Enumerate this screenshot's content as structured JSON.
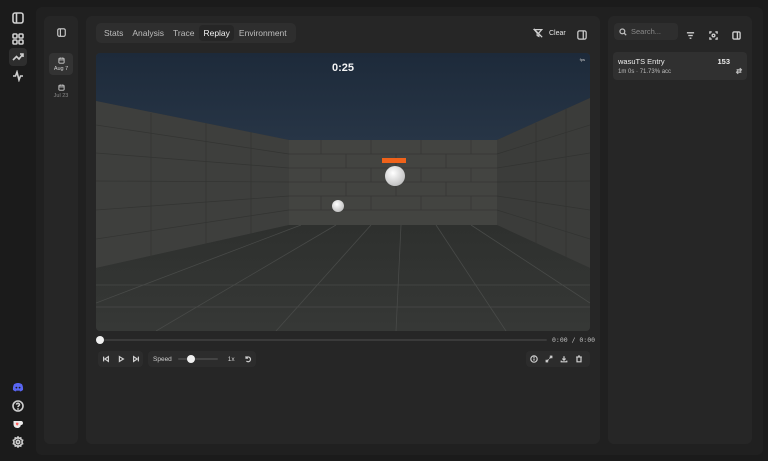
{
  "sidebar": {
    "icons": [
      "sidebar-toggle-icon",
      "grid-icon",
      "trending-up-icon",
      "activity-icon",
      "discord-icon",
      "help-icon",
      "ko-fi-icon",
      "settings-icon"
    ],
    "active": "trending-up-icon"
  },
  "dates": {
    "items": [
      {
        "label": "Aug 7",
        "active": true
      },
      {
        "label": "Jul 23",
        "active": false
      }
    ]
  },
  "tabs": {
    "items": [
      "Stats",
      "Analysis",
      "Trace",
      "Replay",
      "Environment"
    ],
    "active": "Replay"
  },
  "toolbar": {
    "clear_label": "Clear"
  },
  "replay": {
    "timer": "0:25",
    "corner_label": "fps",
    "time_display": "0:00 / 0:00",
    "speed_label": "Speed",
    "speed_value": "1x",
    "speed_fraction": 0.2,
    "progress_fraction": 0.0
  },
  "search": {
    "placeholder": "Search..."
  },
  "entries": [
    {
      "name": "wasuTS Entry",
      "score": "153",
      "duration": "1m 0s",
      "accuracy": "71.73% acc"
    }
  ],
  "colors": {
    "background": "#1b1b1b",
    "panel": "#262626",
    "target_bar": "#f0621a",
    "accent_discord": "#5865f2",
    "accent_kofi": "#ff5e5b"
  }
}
